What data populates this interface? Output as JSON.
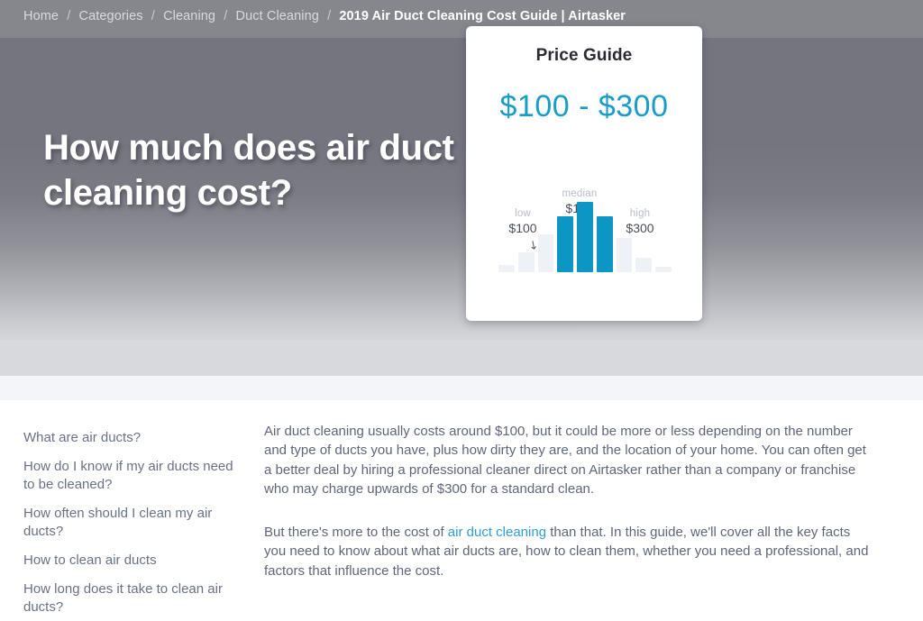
{
  "breadcrumb": {
    "items": [
      "Home",
      "Categories",
      "Cleaning",
      "Duct Cleaning"
    ],
    "separator": "/",
    "current": "2019 Air Duct Cleaning Cost Guide | Airtasker"
  },
  "hero": {
    "headline": "How much does air duct cleaning cost?"
  },
  "price_card": {
    "title": "Price Guide",
    "range": "$100 - $300",
    "low_caption": "low",
    "low_value": "$100",
    "median_caption": "median",
    "median_value": "$150",
    "high_caption": "high",
    "high_value": "$300",
    "arrow_low": "↘",
    "arrow_median": "↓",
    "arrow_high": "↙",
    "accent_color": "#0d95c3",
    "muted_bar_color": "#eef1f6"
  },
  "chart_data": {
    "type": "bar",
    "title": "Price Guide",
    "categories": [
      "b1",
      "b2",
      "b3",
      "low",
      "median",
      "high",
      "b7",
      "b8",
      "b9"
    ],
    "values": [
      8,
      22,
      42,
      62,
      78,
      62,
      38,
      16,
      6
    ],
    "colors": [
      "#eef1f6",
      "#eef1f6",
      "#eef1f6",
      "#0d95c3",
      "#0d95c3",
      "#0d95c3",
      "#eef1f6",
      "#eef1f6",
      "#eef1f6"
    ],
    "annotations": [
      {
        "label": "low",
        "value": "$100",
        "bar_index": 3
      },
      {
        "label": "median",
        "value": "$150",
        "bar_index": 4
      },
      {
        "label": "high",
        "value": "$300",
        "bar_index": 5
      }
    ],
    "xlabel": "",
    "ylabel": "",
    "ylim": [
      0,
      100
    ],
    "grid": false,
    "legend": false
  },
  "sidebar": {
    "items": [
      "What are air ducts?",
      "How do I know if my air ducts need to be cleaned?",
      "How often should I clean my air ducts?",
      "How to clean air ducts",
      "How long does it take to clean air ducts?"
    ]
  },
  "article": {
    "p1": "Air duct cleaning usually costs around $100, but it could be more or less depending on the number and type of ducts you have, plus how dirty they are, and the location of your home. You can often get a better deal by hiring a professional cleaner direct on Airtasker rather than a company or franchise who may charge upwards of $300 for a standard clean.",
    "p2_before": "But there's more to the cost of ",
    "p2_link": "air duct cleaning",
    "p2_after": " than that. In this guide, we'll cover all the key facts you need to know about what air ducts are, how to clean them, whether you need a professional, and factors that influence the cost."
  }
}
